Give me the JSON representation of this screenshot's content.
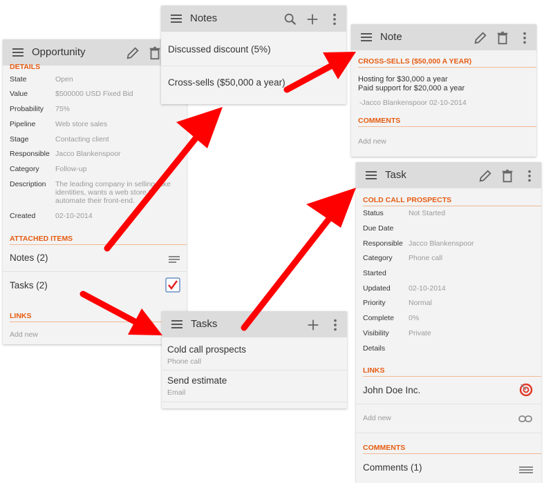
{
  "opportunity": {
    "title": "Opportunity",
    "section_details": "DETAILS",
    "fields": [
      {
        "label": "State",
        "value": "Open"
      },
      {
        "label": "Value",
        "value": "$500000 USD Fixed Bid"
      },
      {
        "label": "Probability",
        "value": "75%"
      },
      {
        "label": "Pipeline",
        "value": "Web store sales"
      },
      {
        "label": "Stage",
        "value": "Contacting client"
      },
      {
        "label": "Responsible",
        "value": "Jacco Blankenspoor"
      },
      {
        "label": "Category",
        "value": "Follow-up"
      },
      {
        "label": "Description",
        "value": "The leading company in selling fake identities, wants a web store to automate their front-end."
      },
      {
        "label": "Created",
        "value": "02-10-2014"
      }
    ],
    "section_attached": "ATTACHED ITEMS",
    "notes_label": "Notes (2)",
    "tasks_label": "Tasks (2)",
    "section_links": "LINKS",
    "add_new": "Add new"
  },
  "notes": {
    "title": "Notes",
    "items": [
      "Discussed discount (5%)",
      "Cross-sells ($50,000 a year)"
    ]
  },
  "note": {
    "title": "Note",
    "heading": "CROSS-SELLS ($50,000 A YEAR)",
    "line1": "Hosting for $30,000 a year",
    "line2": "Paid support for $20,000 a year",
    "signature": "-Jacco Blankenspoor 02-10-2014",
    "section_comments": "COMMENTS",
    "add_new": "Add new"
  },
  "tasks": {
    "title": "Tasks",
    "items": [
      {
        "title": "Cold call prospects",
        "sub": "Phone call"
      },
      {
        "title": "Send estimate",
        "sub": "Email"
      }
    ]
  },
  "task": {
    "title": "Task",
    "heading": "COLD CALL PROSPECTS",
    "fields": [
      {
        "label": "Status",
        "value": "Not Started"
      },
      {
        "label": "Due Date",
        "value": ""
      },
      {
        "label": "Responsible",
        "value": "Jacco Blankenspoor"
      },
      {
        "label": "Category",
        "value": "Phone call"
      },
      {
        "label": "Started",
        "value": ""
      },
      {
        "label": "Updated",
        "value": "02-10-2014"
      },
      {
        "label": "Priority",
        "value": "Normal"
      },
      {
        "label": "Complete",
        "value": "0%"
      },
      {
        "label": "Visibility",
        "value": "Private"
      },
      {
        "label": "Details",
        "value": ""
      }
    ],
    "section_links": "LINKS",
    "link_name": "John Doe Inc.",
    "add_new": "Add new",
    "section_comments": "COMMENTS",
    "comments_label": "Comments (1)"
  },
  "icons": {
    "menu": "menu-icon",
    "edit": "pencil-icon",
    "delete": "trash-icon",
    "more": "more-vertical-icon",
    "search": "search-icon",
    "add": "plus-icon",
    "notes_list": "notes-list-icon",
    "task_check": "checkbox-checked-icon",
    "target": "target-icon",
    "link": "link-icon"
  },
  "colors": {
    "accent": "#e65c12",
    "arrow": "#ff0000",
    "toolbar": "#dcdcdc",
    "panel": "#f3f3f3"
  }
}
